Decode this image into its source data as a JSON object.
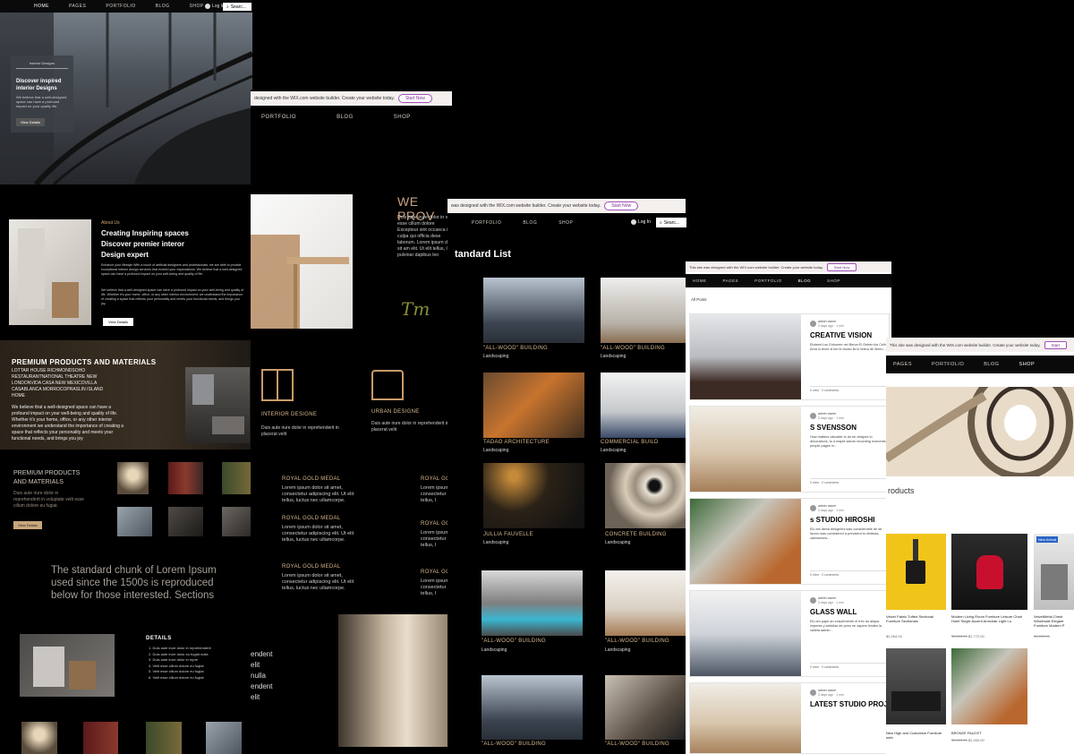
{
  "panel1": {
    "nav": [
      "HOME",
      "PAGES",
      "PORTFOLIO",
      "BLOG",
      "SHOP"
    ],
    "login": "Log In",
    "search_placeholder": "Searc...",
    "hero_tag": "Interior Designs",
    "hero_title": "Discover inspired interior Designs",
    "hero_desc": "We believe that a well-designed space can have a profound impact on your quality life.",
    "hero_button": "View Details",
    "about_label": "About Us",
    "about_title": "Creating Inspiring spaces Discover premier interor Design expert",
    "about_desc1": "Enhance your lifestyle With a touch of artificial designers and professionals, we are able to provide exceptional interior design services that exceed your expectations. We believe that a well-designed space can have a profound impact on your well-being and quality of life.",
    "about_desc2": "We believe that a well-designed space can have a profound impact on your well-being and quality of life. Whether it's your home, office, or any other interior environment, we understand the importance of creating a space that reflects your personality and meets your functional needs, and brings you joy.",
    "about_button": "View Details",
    "premium_title": "PREMIUM PRODUCTS AND MATERIALS",
    "premium_list": "LOTTAR HOUSE RICHMONDSOHO RESTAURANTNATIONAL THEATRE NEW LONDONVIDA CASA NEW MEXICOVILLA CASABLANCA MORROCOPRASLIN ISLAND HOME",
    "premium_desc": "We believe that a well-designed space can have a profound impact on your well-being and quality of life. Whether it's your home, office, or any other interior environment we understand the importance of creating a space that reflects your personality and meets your functional needs, and brings you joy",
    "premium2_title": "PREMIUM PRODUCTS AND MATERIALS",
    "premium2_desc": "Duis aute irure dolor in reprehenderit in voluptate velit esse cillum dolore eu fugiat.",
    "premium2_button": "View Details",
    "lorem_heading": "The standard chunk of Lorem Ipsum used since the 1500s is reproduced below for those interested. Sections",
    "details_title": "DETAILS",
    "details_list": [
      "Duis aute irure dolor in reprehenderit",
      "Duis aute irure dolor eu fugiat nulla",
      "Duis aute irure dolor in repre",
      "Velit esse cillum dolore eu fugiat",
      "Velit esse cillum dolore eu fugiat",
      "Velit esse cillum dolore eu fugiat"
    ]
  },
  "panel2": {
    "wix_text": "designed with the WIX.com website builder. Create your website today.",
    "wix_button": "Start Now",
    "nav": [
      "PORTFOLIO",
      "BLOG",
      "SHOP"
    ],
    "heading": "WE PROV",
    "intro": "Duis aute irure dolor in velit esse cillum dolore Excepteur sint occaeca in culpa qui officia dese laborum. Lorem ipsum dolor sit am elit. Ut elit tellus, luct pulvinar dapibus leo",
    "signature": "Tm",
    "service1_title": "INTERIOR DESIGNE",
    "service1_desc": "Duis aute irure dolor in reprehenderit in placerat velit",
    "service2_title": "URBAN DESIGNE",
    "service2_desc": "Duis aute irure dolor in reprehenderit in placerat velit",
    "medals": [
      {
        "title": "ROYAL GOLD MEDAL",
        "desc": "Lorem ipsum dolor sit amet, consectetur adipiscing elit. Ut elit tellus, luctus nec ullamcorpe."
      },
      {
        "title": "ROYAL GOLD MEDAL",
        "desc": "Lorem ipsum dolor sit amet, consectetur adipiscing elit. Ut elit tellus, luctus nec ullamcorpe."
      },
      {
        "title": "ROYAL GOLD MEDAL",
        "desc": "Lorem ipsum dolor sit amet, consectetur adipiscing elit. Ut elit tellus, luctus nec ullamcorpe."
      }
    ],
    "medals_right": [
      {
        "title": "ROYAL GO",
        "desc": "Lorem ipsum consectetur elit tellus, l"
      },
      {
        "title": "ROYAL GO",
        "desc": "Lorem ipsum consectetur elit tellus, l"
      },
      {
        "title": "ROYAL GO",
        "desc": "Lorem ipsum consectetur elit tellus, l"
      }
    ],
    "cut_text": "endent elit nulla endent elit"
  },
  "panel3": {
    "wix_text": "was designed with the WIX.com website builder. Create your website today.",
    "wix_button": "Start Now",
    "nav": [
      "PORTFOLIO",
      "BLOG",
      "SHOP"
    ],
    "login": "Log In",
    "search_placeholder": "Searc...",
    "title": "tandard List",
    "projects": [
      {
        "name": "\"ALL-WOOD\" BUILDING",
        "cat": "Landscaping"
      },
      {
        "name": "\"ALL-WOOD\" BUILDING",
        "cat": "Landscaping"
      },
      {
        "name": "TADAO ARCHITECTURE",
        "cat": "Landscaping"
      },
      {
        "name": "COMMERCIAL BUILD",
        "cat": "Landscaping"
      },
      {
        "name": "JULLIA FAUVELLE",
        "cat": "Landscaping"
      },
      {
        "name": "CONCRETE BUILDING",
        "cat": "Landscaping"
      },
      {
        "name": "\"ALL-WOOD\" BUILDING",
        "cat": "Landscaping"
      },
      {
        "name": "\"ALL-WOOD\" BUILDING",
        "cat": "Landscaping"
      },
      {
        "name": "\"ALL-WOOD\" BUILDING",
        "cat": "Landscaping"
      },
      {
        "name": "\"ALL-WOOD\" BUILDING",
        "cat": "Landscaping"
      }
    ]
  },
  "panel4": {
    "wix_text": "This site was designed with the WIX.com website builder. Create your website today.",
    "wix_button": "Start Now",
    "nav": [
      "HOME",
      "PAGES",
      "PORTFOLIO",
      "BLOG",
      "SHOP"
    ],
    "filter": "All Posts",
    "posts": [
      {
        "author": "admin·owner",
        "date": "3 days ago · 1 min",
        "title": "CREATIVE VISION",
        "excerpt": "Elofamt Lou Enlooree nel Berva El Geben kis Cello Ama lo teure si lee le lavato lis lo testra de libreo...",
        "stats": "0 view  · 0 comments"
      },
      {
        "author": "admin·owner",
        "date": "3 days ago · 1 min",
        "title": "S SVENSSON",
        "excerpt": "How matters valuable to do be desipes to decorations, to a maple saturn recording moments, people pages in...",
        "stats": "0 view  · 0 comments"
      },
      {
        "author": "admin·owner",
        "date": "3 days ago · 1 min",
        "title": "s STUDIO HIROSHI",
        "excerpt": "Elo am llama designers was considerable de de lavoro was considered a prevalent la diniticas, valoracions...",
        "stats": "0 view  · 0 comments"
      },
      {
        "author": "admin·owner",
        "date": "3 days ago · 1 min",
        "title": "GLASS WALL",
        "excerpt": "Elo am pape an exsplemente el freo do aliqua impenta y activitas de pono en sapers lendes la valleta admin...",
        "stats": "0 view  · 0 comments"
      },
      {
        "author": "admin·owner",
        "date": "3 days ago · 1 min",
        "title": "LATEST STUDIO PROJ",
        "excerpt": "",
        "stats": ""
      }
    ]
  },
  "panel5": {
    "wix_text": "This site was designed with the WIX.com website builder. Create your website today.",
    "wix_button": "Start",
    "nav": [
      "PAGES",
      "PORTFOLIO",
      "BLOG",
      "SHOP"
    ],
    "section_title": "roducts",
    "products": [
      {
        "name": "Velvet Fabric Tufted Sectional Furniture Sectionals",
        "price": "$2,264.00",
        "old": "$3,264.00",
        "badge": ""
      },
      {
        "name": "Modern Living Room Furniture Leisure Chair Hotel Single Accent Armchair Light Lu",
        "price": "$2,772.00",
        "old": "$3,850.00",
        "badge": ""
      },
      {
        "name": "VelvetMetal Chest Wholesale Elegant Furniture Modern P",
        "price": "$1,200.00",
        "old": "$1,800.00",
        "badge": "New Arrival"
      },
      {
        "name": "New High and Customize Furniture sofa",
        "price": "$2,000.00",
        "old": "$3,000.00",
        "badge": ""
      },
      {
        "name": "BRONZE FAUCET",
        "price": "$2,000.00",
        "old": "$3,000.00",
        "badge": ""
      }
    ]
  }
}
